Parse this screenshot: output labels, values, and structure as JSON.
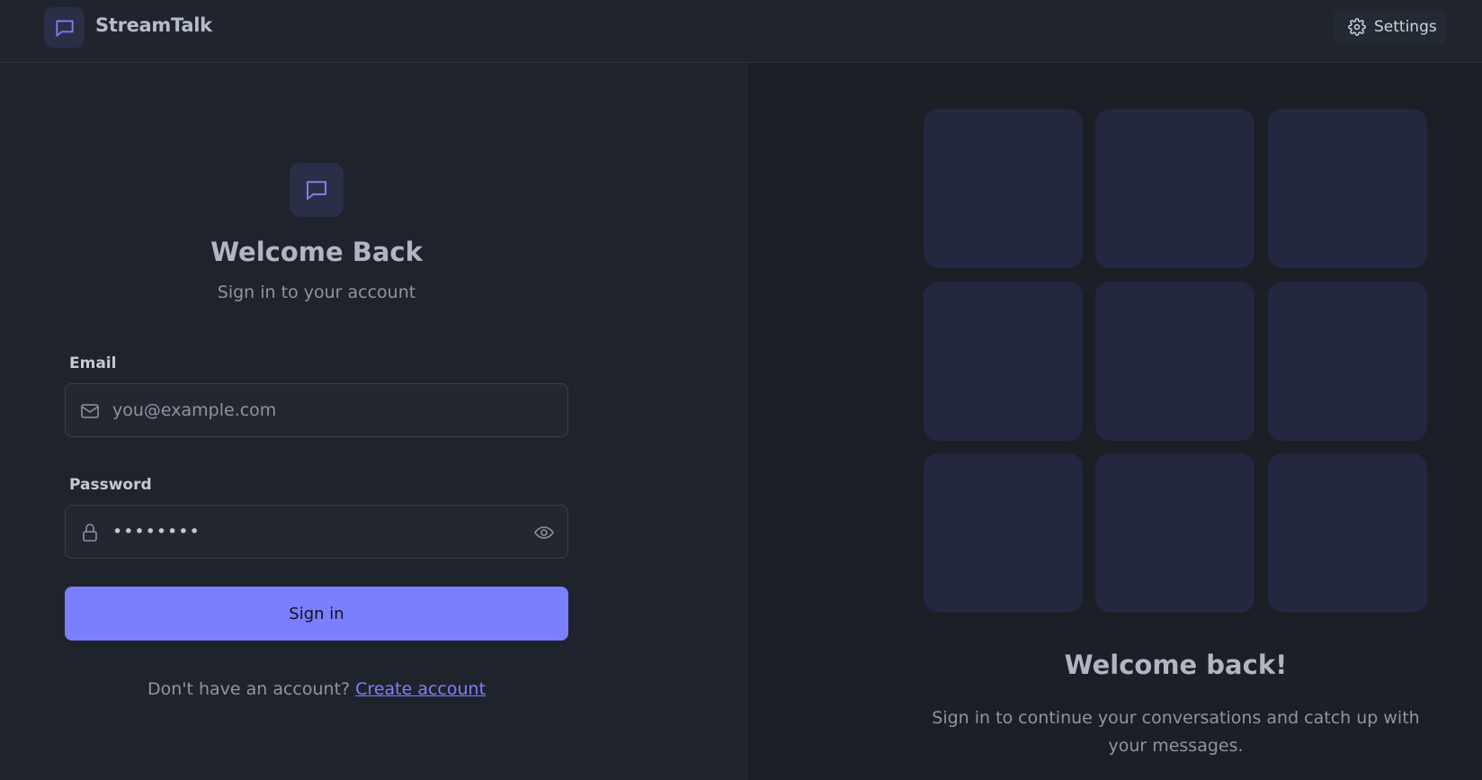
{
  "header": {
    "app_title": "StreamTalk",
    "settings_label": "Settings"
  },
  "login": {
    "title": "Welcome Back",
    "subtitle": "Sign in to your account",
    "email_label": "Email",
    "email_placeholder": "you@example.com",
    "password_label": "Password",
    "password_value": "••••••••",
    "signin_label": "Sign in",
    "signup_prompt": "Don't have an account?",
    "signup_link": "Create account"
  },
  "showcase": {
    "tiles": 9,
    "title": "Welcome back!",
    "subtitle": "Sign in to continue your conversations and catch up with your messages."
  },
  "colors": {
    "accent": "#7a7ffd",
    "background": "#1f232c",
    "tile": "#242740"
  },
  "icons": {
    "logo": "chat-bubble-icon",
    "settings": "gear-icon",
    "email": "mail-icon",
    "password": "lock-icon",
    "toggle_visibility": "eye-icon"
  }
}
